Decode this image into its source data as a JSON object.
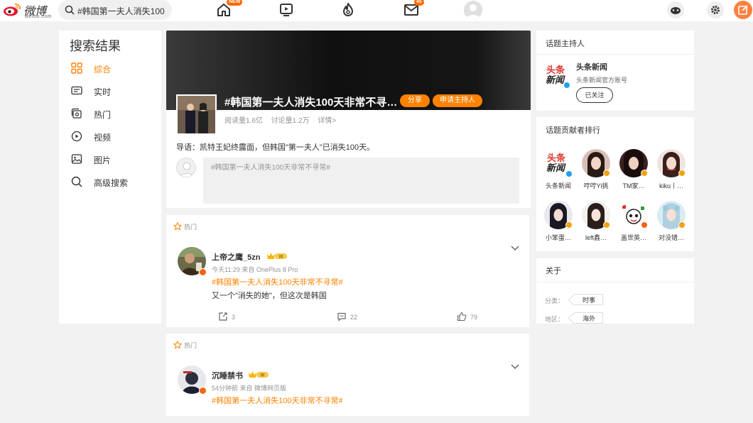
{
  "app": {
    "logo_text": "微博",
    "logo_sub": "weibo.com"
  },
  "search": {
    "value": "#韩国第一夫人消失100"
  },
  "nav": {
    "home_badge": "NEW",
    "messages_badge": "45"
  },
  "sidebar": {
    "title": "搜索结果",
    "items": [
      {
        "label": "综合",
        "icon": "grid-icon",
        "active": true
      },
      {
        "label": "实时",
        "icon": "realtime-icon",
        "active": false
      },
      {
        "label": "热门",
        "icon": "hot-icon",
        "active": false
      },
      {
        "label": "视频",
        "icon": "video-icon",
        "active": false
      },
      {
        "label": "图片",
        "icon": "image-icon",
        "active": false
      },
      {
        "label": "高级搜索",
        "icon": "search-icon",
        "active": false
      }
    ]
  },
  "topic": {
    "title": "#韩国第一夫人消失100天非常不寻…",
    "share_label": "分享",
    "host_apply_label": "申请主持人",
    "reads": "阅读量1.6亿",
    "discussions": "讨论量1.2万",
    "details": "详情>",
    "lead": "导语：凯特王妃终露面，但韩国\"第一夫人\"已消失100天。",
    "compose_placeholder": "#韩国第一夫人消失100天非常不寻常#"
  },
  "posts": [
    {
      "hot_label": "热门",
      "author": "上帝之鹰_5zn",
      "level": "III",
      "meta": "今天11:29  来自 OnePlus 8 Pro",
      "topic": "#韩国第一夫人消失100天非常不寻常#",
      "text": "又一个\"消失的她\"，但这次是韩国",
      "reposts": "3",
      "comments": "22",
      "likes": "79"
    },
    {
      "hot_label": "热门",
      "author": "沉睡禁书",
      "level": "III",
      "meta": "54分钟前  来自 微博网页版",
      "topic": "#韩国第一夫人消失100天非常不寻常#"
    }
  ],
  "host": {
    "section_title": "话题主持人",
    "logo_line1": "头条",
    "logo_line2": "新闻",
    "name": "头条新闻",
    "desc": "头条新闻官方账号",
    "follow_label": "已关注"
  },
  "contributors": {
    "section_title": "话题贡献者排行",
    "list": [
      {
        "name": "头条新闻"
      },
      {
        "name": "哼哼Yi挑"
      },
      {
        "name": "TM家…"
      },
      {
        "name": "kiku丨…"
      },
      {
        "name": "小笨蛋…"
      },
      {
        "name": "left鑫…"
      },
      {
        "name": "盖世英…"
      },
      {
        "name": "对没错…"
      }
    ]
  },
  "about": {
    "section_title": "关于",
    "category_key": "分类：",
    "category_value": "时事",
    "region_key": "地区：",
    "region_value": "海外"
  },
  "colors": {
    "accent": "#ff8200",
    "background": "#f2f2f2"
  }
}
